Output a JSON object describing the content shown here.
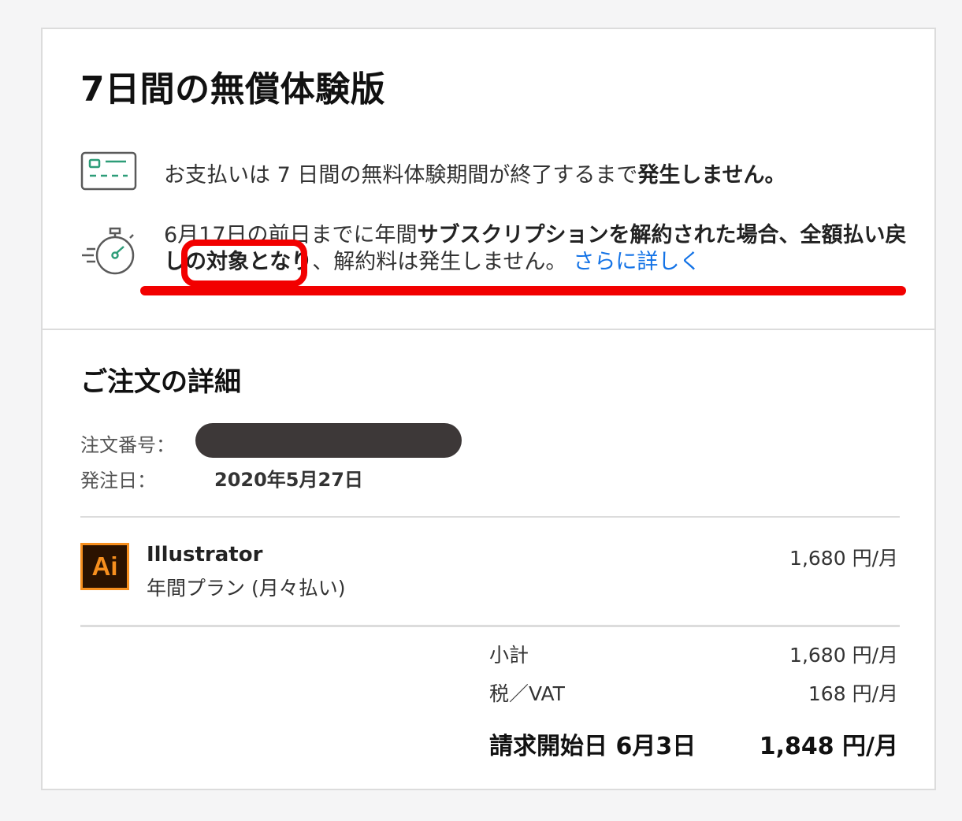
{
  "trial": {
    "title": "7日間の無償体験版",
    "payment_note_pre": "お支払いは 7 日間の無料体験期間が終了するまで",
    "payment_note_bold": "発生しません。",
    "cancel_date": "6月17日",
    "cancel_text_1": "の前日までに年間",
    "cancel_text_bold": "サブスクリプションを解約された場合、全額払い戻しの対象となり",
    "cancel_text_2": "、解約料は発生しません。",
    "learn_more_link": "さらに詳しく"
  },
  "order": {
    "section_title": "ご注文の詳細",
    "order_number_label": "注文番号：",
    "order_date_label": "発注日：",
    "order_date": "2020年5月27日",
    "item": {
      "logo_text": "Ai",
      "name": "Illustrator",
      "plan": "年間プラン (月々払い)",
      "price": "1,680 円/月"
    },
    "subtotal_label": "小計",
    "subtotal_value": "1,680 円/月",
    "tax_label": "税／VAT",
    "tax_value": "168 円/月",
    "billing_start_label": "請求開始日 6月3日",
    "billing_total": "1,848 円/月"
  },
  "icons": {
    "card": "credit-card-icon",
    "timer": "stopwatch-icon"
  },
  "colors": {
    "link": "#1473e6",
    "annotation_red": "#f20000",
    "ai_orange": "#f78f1e",
    "ai_bg": "#2b1200",
    "icon_green": "#2d9d78"
  }
}
